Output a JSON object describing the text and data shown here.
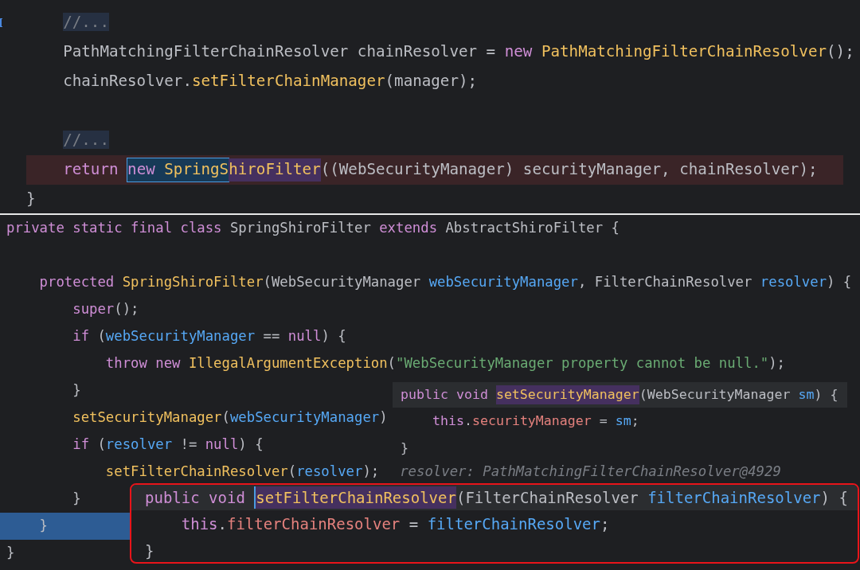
{
  "panels": [
    {
      "kind": "top",
      "lines": [
        {
          "kind": "fold",
          "tokens": [
            {
              "text": "//...",
              "kind": "folded"
            }
          ]
        },
        {
          "kind": "code",
          "tokens": [
            {
              "text": "    PathMatchingFilterChainResolver chainResolver = ",
              "kind": "plain"
            },
            {
              "text": "new ",
              "kind": "keyword"
            },
            {
              "text": "PathMatchingFilterChainResolver",
              "kind": "method"
            },
            {
              "text": "();",
              "kind": "plain"
            }
          ]
        },
        {
          "kind": "code",
          "tokens": [
            {
              "text": "    chainResolver.",
              "kind": "plain"
            },
            {
              "text": "setFilterChainManager",
              "kind": "method"
            },
            {
              "text": "(manager);",
              "kind": "plain"
            }
          ]
        },
        {
          "kind": "blank"
        },
        {
          "kind": "fold",
          "tokens": [
            {
              "text": "//...",
              "kind": "folded"
            }
          ]
        },
        {
          "kind": "error",
          "tokens": [
            {
              "text": "    return ",
              "kind": "keyword"
            },
            {
              "text": "new ",
              "kind": "keyword",
              "boxed": true
            },
            {
              "text": "SpringS",
              "kind": "method",
              "boxed": true
            },
            {
              "text": "hiroFilter",
              "kind": "method",
              "matched": true
            },
            {
              "text": "((WebSecurityManager) securityManager, chainResolver);",
              "kind": "plain"
            }
          ]
        },
        {
          "kind": "code",
          "tokens": [
            {
              "text": "}",
              "kind": "plain"
            }
          ]
        }
      ]
    },
    {
      "kind": "bottom",
      "lines": [
        {
          "kind": "code",
          "tokens": [
            {
              "text": "private static final class ",
              "kind": "keyword"
            },
            {
              "text": "SpringShiroFilter ",
              "kind": "plain"
            },
            {
              "text": "extends ",
              "kind": "keyword"
            },
            {
              "text": "AbstractShiroFilter {",
              "kind": "plain"
            }
          ]
        },
        {
          "kind": "blank"
        },
        {
          "kind": "code",
          "tokens": [
            {
              "text": "    protected ",
              "kind": "keyword"
            },
            {
              "text": "SpringShiroFilter",
              "kind": "method"
            },
            {
              "text": "(WebSecurityManager ",
              "kind": "plain"
            },
            {
              "text": "webSecurityManager",
              "kind": "param"
            },
            {
              "text": ", FilterChainResolver ",
              "kind": "plain"
            },
            {
              "text": "resolver",
              "kind": "param"
            },
            {
              "text": ") {",
              "kind": "plain"
            }
          ]
        },
        {
          "kind": "code",
          "tokens": [
            {
              "text": "        super",
              "kind": "keyword"
            },
            {
              "text": "();",
              "kind": "plain"
            }
          ]
        },
        {
          "kind": "code",
          "tokens": [
            {
              "text": "        if",
              "kind": "keyword"
            },
            {
              "text": " (",
              "kind": "plain"
            },
            {
              "text": "webSecurityManager",
              "kind": "param"
            },
            {
              "text": " == ",
              "kind": "plain"
            },
            {
              "text": "null",
              "kind": "keyword"
            },
            {
              "text": ") {",
              "kind": "plain"
            }
          ]
        },
        {
          "kind": "code",
          "tokens": [
            {
              "text": "            throw new ",
              "kind": "keyword"
            },
            {
              "text": "IllegalArgumentException",
              "kind": "method"
            },
            {
              "text": "(",
              "kind": "plain"
            },
            {
              "text": "\"WebSecurityManager property cannot be null.\"",
              "kind": "string"
            },
            {
              "text": ");",
              "kind": "plain"
            }
          ]
        },
        {
          "kind": "code",
          "tokens": [
            {
              "text": "        }",
              "kind": "plain"
            }
          ]
        },
        {
          "kind": "code",
          "tokens": [
            {
              "text": "        setSecurityManager",
              "kind": "method"
            },
            {
              "text": "(",
              "kind": "plain"
            },
            {
              "text": "webSecurityManager",
              "kind": "param"
            },
            {
              "text": ")",
              "kind": "plain"
            }
          ]
        },
        {
          "kind": "code",
          "tokens": [
            {
              "text": "        if",
              "kind": "keyword"
            },
            {
              "text": " (",
              "kind": "plain"
            },
            {
              "text": "resolver",
              "kind": "param"
            },
            {
              "text": " != ",
              "kind": "plain"
            },
            {
              "text": "null",
              "kind": "keyword"
            },
            {
              "text": ") {",
              "kind": "plain"
            }
          ]
        },
        {
          "kind": "code",
          "tokens": [
            {
              "text": "            setFilterChainResolver",
              "kind": "method"
            },
            {
              "text": "(",
              "kind": "plain"
            },
            {
              "text": "resolver",
              "kind": "param"
            },
            {
              "text": ");",
              "kind": "plain"
            },
            {
              "text": "resolver: PathMatchingFilterChainResolver@4929",
              "kind": "hint"
            }
          ]
        },
        {
          "kind": "code",
          "tokens": [
            {
              "text": "        }",
              "kind": "plain"
            }
          ]
        },
        {
          "kind": "selection",
          "tokens": [
            {
              "text": "    }",
              "kind": "plain"
            }
          ]
        },
        {
          "kind": "code",
          "tokens": [
            {
              "text": "}",
              "kind": "plain"
            }
          ]
        }
      ],
      "popups": [
        {
          "outlined": false,
          "lines": [
            {
              "kind": "header",
              "tokens": [
                {
                  "text": "public void ",
                  "kind": "keyword"
                },
                {
                  "text": "setSecurityManager",
                  "kind": "method",
                  "matched": true
                },
                {
                  "text": "(WebSecurityManager ",
                  "kind": "plain"
                },
                {
                  "text": "sm",
                  "kind": "param"
                },
                {
                  "text": ") {",
                  "kind": "plain"
                }
              ]
            },
            {
              "kind": "code",
              "tokens": [
                {
                  "text": "    this",
                  "kind": "keyword"
                },
                {
                  "text": ".",
                  "kind": "plain"
                },
                {
                  "text": "securityManager",
                  "kind": "field"
                },
                {
                  "text": " = ",
                  "kind": "plain"
                },
                {
                  "text": "sm",
                  "kind": "param"
                },
                {
                  "text": ";",
                  "kind": "plain"
                }
              ]
            },
            {
              "kind": "code",
              "tokens": [
                {
                  "text": "}",
                  "kind": "plain"
                }
              ]
            }
          ]
        },
        {
          "outlined": true,
          "lines": [
            {
              "kind": "header",
              "tokens": [
                {
                  "text": "public void ",
                  "kind": "keyword"
                },
                {
                  "text": "setFilterChainResolver",
                  "kind": "method",
                  "matched": true,
                  "caret": true
                },
                {
                  "text": "(FilterChainResolver ",
                  "kind": "plain"
                },
                {
                  "text": "filterChainResolver",
                  "kind": "param"
                },
                {
                  "text": ") {",
                  "kind": "plain"
                }
              ]
            },
            {
              "kind": "code",
              "tokens": [
                {
                  "text": "    this",
                  "kind": "keyword"
                },
                {
                  "text": ".",
                  "kind": "plain"
                },
                {
                  "text": "filterChainResolver",
                  "kind": "field"
                },
                {
                  "text": " = ",
                  "kind": "plain"
                },
                {
                  "text": "filterChainResolver",
                  "kind": "param"
                },
                {
                  "text": ";",
                  "kind": "plain"
                }
              ]
            },
            {
              "kind": "code",
              "tokens": [
                {
                  "text": "}",
                  "kind": "plain"
                }
              ]
            }
          ]
        }
      ]
    }
  ]
}
